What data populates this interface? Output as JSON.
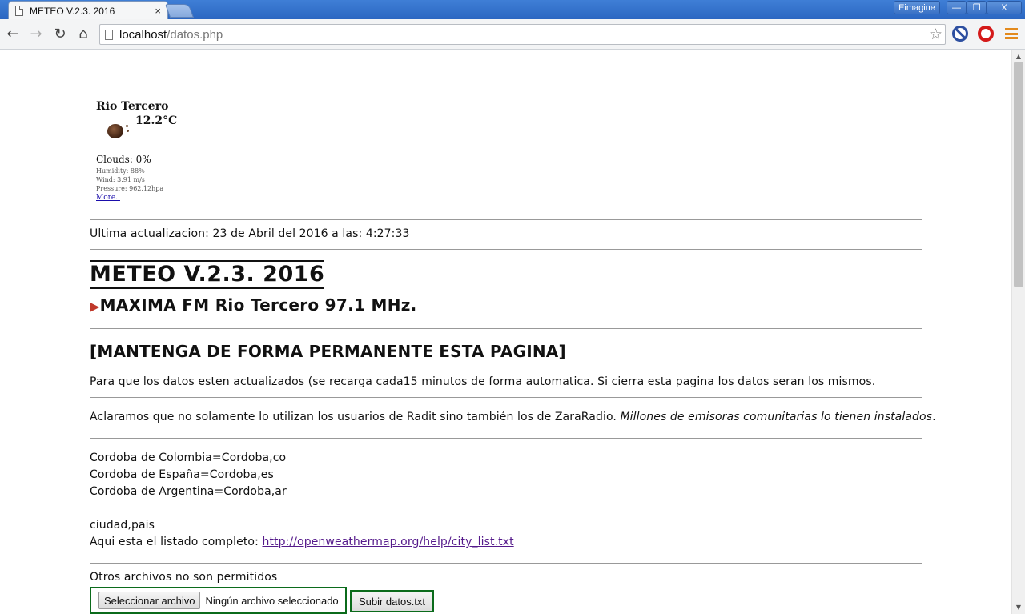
{
  "browser": {
    "tab_title": "METEO V.2.3. 2016",
    "tab_close": "×",
    "user_label": "Eimagine",
    "win_min": "—",
    "win_max": "❐",
    "win_close": "X",
    "url_host": "localhost",
    "url_path": "/datos.php"
  },
  "weather_widget": {
    "city": "Rio Tercero",
    "temperature": "12.2°C",
    "clouds": "Clouds: 0%",
    "humidity": "Humidity: 88%",
    "wind": "Wind: 3.91 m/s",
    "pressure": "Pressure: 962.12hpa",
    "more_link": "More.."
  },
  "page": {
    "last_update": "Ultima actualizacion: 23 de Abril del 2016 a las: 4:27:33",
    "title": "METEO V.2.3. 2016",
    "station": "MAXIMA FM Rio Tercero 97.1 MHz.",
    "keep_heading": "[MANTENGA DE FORMA PERMANENTE ESTA PAGINA]",
    "keep_text": "Para que los datos esten actualizados (se recarga cada15 minutos de forma automatica. Si cierra esta pagina los datos seran los mismos.",
    "clarify_text": "Aclaramos que no solamente lo utilizan los usuarios de Radit sino también los de ZaraRadio.",
    "clarify_italic": "Millones de emisoras comunitarias lo tienen instalados",
    "clarify_end": ".",
    "examples": [
      "Cordoba de Colombia=Cordoba,co",
      "Cordoba de España=Cordoba,es",
      "Cordoba de Argentina=Cordoba,ar"
    ],
    "format": "ciudad,pais",
    "list_prefix": "Aqui esta el listado completo: ",
    "list_link": "http://openweathermap.org/help/city_list.txt",
    "files_note": "Otros archivos no son permitidos",
    "file_button": "Seleccionar archivo",
    "file_status": "Ningún archivo seleccionado",
    "submit_button": "Subir datos.txt"
  }
}
